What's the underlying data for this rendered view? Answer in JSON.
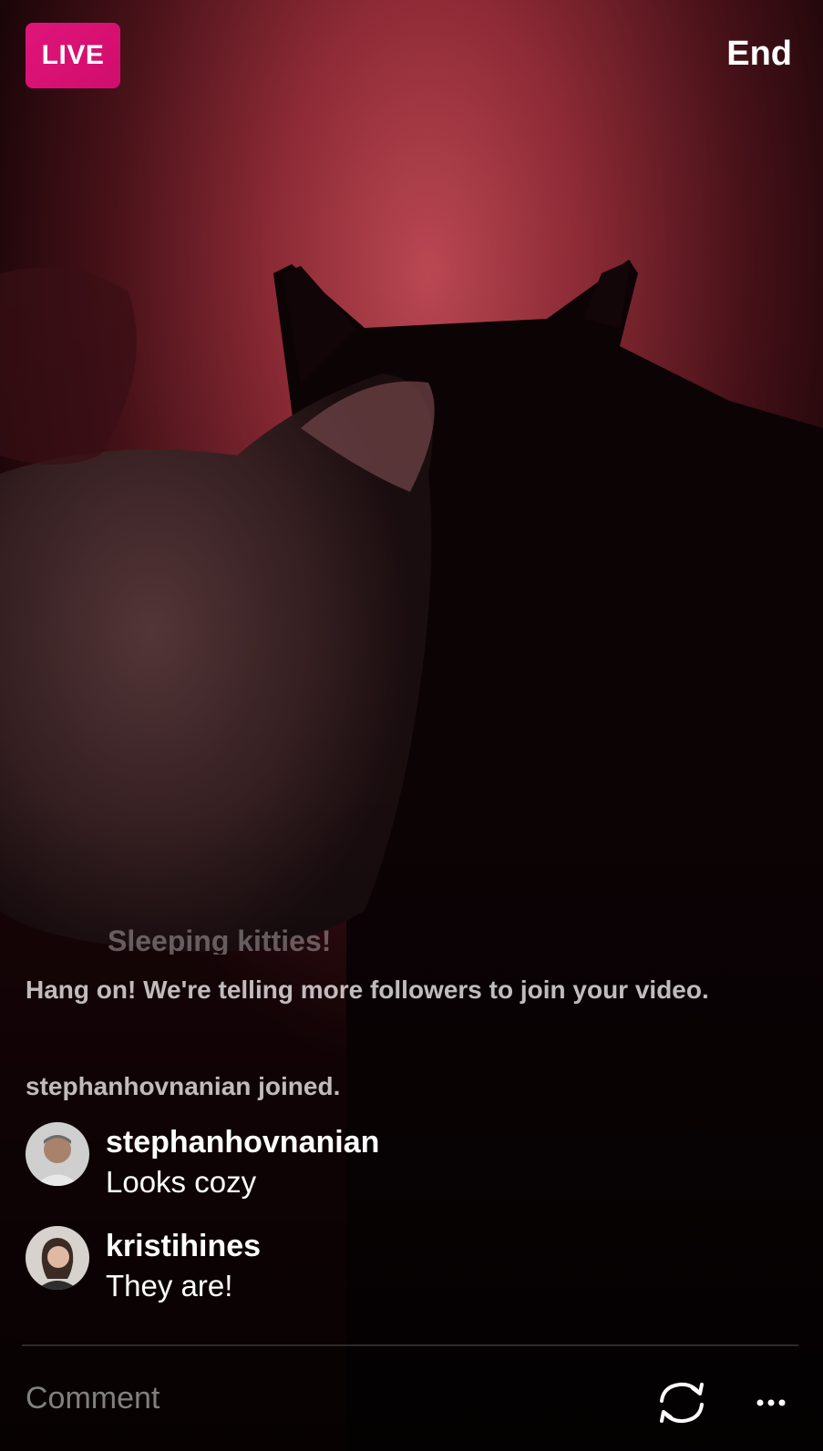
{
  "header": {
    "live_badge": "LIVE",
    "end_label": "End"
  },
  "broadcast": {
    "title_partial": "Sleeping kitties!"
  },
  "feed": {
    "system_messages": [
      "Hang on! We're telling more followers to join your video.",
      "stephanhovnanian joined."
    ],
    "comments": [
      {
        "username": "stephanhovnanian",
        "text": "Looks cozy"
      },
      {
        "username": "kristihines",
        "text": "They are!"
      }
    ]
  },
  "footer": {
    "comment_placeholder": "Comment",
    "flip_camera_icon": "camera-flip-icon",
    "more_icon": "more-options-icon"
  },
  "colors": {
    "live_badge": "#d91172",
    "background_red": "#8a2a33",
    "text": "#ffffff"
  }
}
